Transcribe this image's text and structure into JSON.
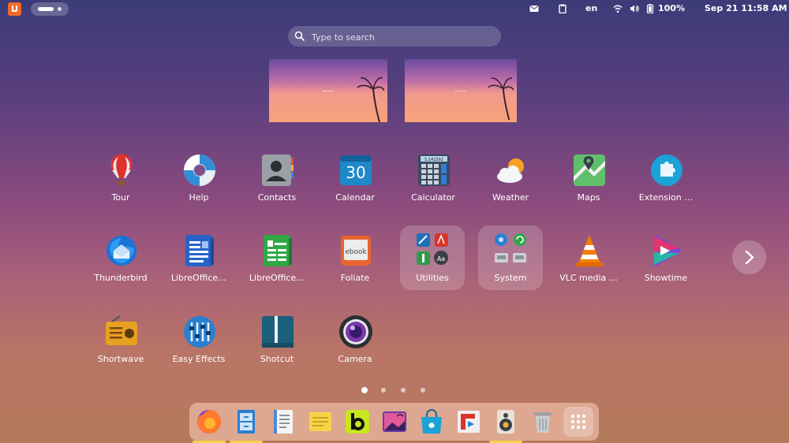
{
  "topbar": {
    "language": "en",
    "battery": "100%",
    "datetime": "Sep 21  11:58 AM",
    "icons": [
      "logo-icon",
      "workspace-indicator",
      "mail-icon",
      "clipboard-icon",
      "wifi-icon",
      "volume-icon",
      "battery-icon"
    ]
  },
  "search": {
    "placeholder": "Type to search"
  },
  "grid": {
    "row1": [
      "Tour",
      "Help",
      "Contacts",
      "Calendar",
      "Calculator",
      "Weather",
      "Maps",
      "Extension …"
    ],
    "row2": [
      "Thunderbird",
      "LibreOffice…",
      "LibreOffice…",
      "Foliate",
      "Utilities",
      "System",
      "VLC media …",
      "Showtime"
    ],
    "row3": [
      "Shortwave",
      "Easy Effects",
      "Shotcut",
      "Camera"
    ],
    "calendar_day": "30",
    "calculator_display": "5,141592"
  },
  "pager": {
    "pages": 4,
    "current": 1
  },
  "dock": {
    "items": [
      "Firefox",
      "Files",
      "Text Editor",
      "Notes",
      "Bluefish",
      "Image Viewer",
      "Software",
      "Flowblade",
      "Rhythmbox",
      "Trash",
      "Show Apps"
    ],
    "running": [
      "Firefox",
      "Files",
      "Rhythmbox"
    ]
  },
  "colors": {
    "accent": "#f26b2b",
    "running": "#f6d44a",
    "panel": "#ffcdb9"
  }
}
